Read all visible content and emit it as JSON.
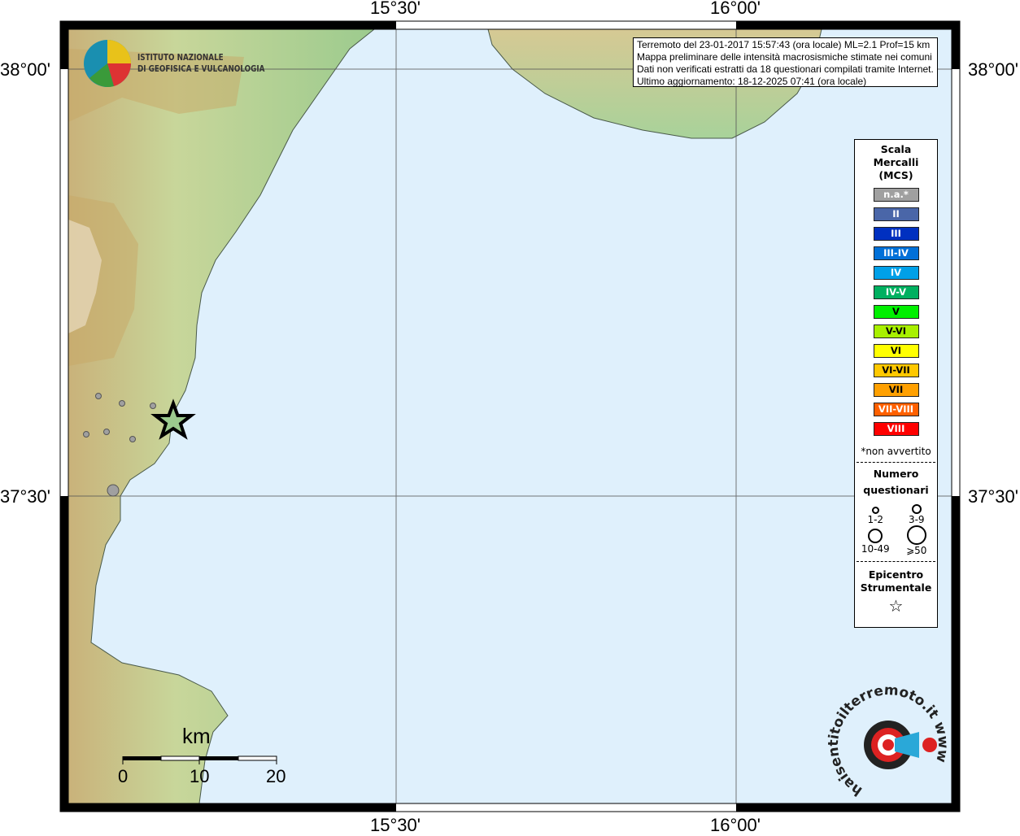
{
  "axes": {
    "lon_ticks": [
      "15°30'",
      "16°00'"
    ],
    "lat_ticks": [
      "38°00'",
      "37°30'"
    ]
  },
  "info": {
    "lines": [
      "Terremoto del 23-01-2017 15:57:43 (ora locale) ML=2.1 Prof=15 km",
      "Mappa preliminare delle intensità macrosismiche stimate nei comuni",
      "Dati non verificati estratti da 18 questionari compilati tramite Internet.",
      "Ultimo aggiornamento: 18-12-2025 07:41 (ora locale)"
    ]
  },
  "ingv_logo": {
    "line1": "ISTITUTO NAZIONALE",
    "line2": "DI GEOFISICA E VULCANOLOGIA"
  },
  "legend": {
    "title": [
      "Scala",
      "Mercalli",
      "(MCS)"
    ],
    "scale": [
      {
        "label": "n.a.*",
        "color": "#a0a0a0"
      },
      {
        "label": "II",
        "color": "#4a66a8"
      },
      {
        "label": "III",
        "color": "#0030c0"
      },
      {
        "label": "III-IV",
        "color": "#0070d8"
      },
      {
        "label": "IV",
        "color": "#00a0e8"
      },
      {
        "label": "IV-V",
        "color": "#00b060"
      },
      {
        "label": "V",
        "color": "#00f000"
      },
      {
        "label": "V-VI",
        "color": "#a8f000"
      },
      {
        "label": "VI",
        "color": "#ffff00"
      },
      {
        "label": "VI-VII",
        "color": "#ffc800"
      },
      {
        "label": "VII",
        "color": "#ffa000"
      },
      {
        "label": "VII-VIII",
        "color": "#ff6000"
      },
      {
        "label": "VIII",
        "color": "#ff0000"
      }
    ],
    "not_felt": "*non avvertito",
    "count_title": [
      "Numero",
      "questionari"
    ],
    "counts": [
      "1-2",
      "3-9",
      "10-49",
      "⩾50"
    ],
    "epi_title": [
      "Epicentro",
      "Strumentale"
    ]
  },
  "scale_bar": {
    "unit": "km",
    "labels": [
      "0",
      "10",
      "20"
    ]
  },
  "watermark": {
    "text": "haisentitoilterremoto.it www"
  },
  "colors": {
    "sea": "#dff0fc",
    "point": "#a0a0a0"
  }
}
